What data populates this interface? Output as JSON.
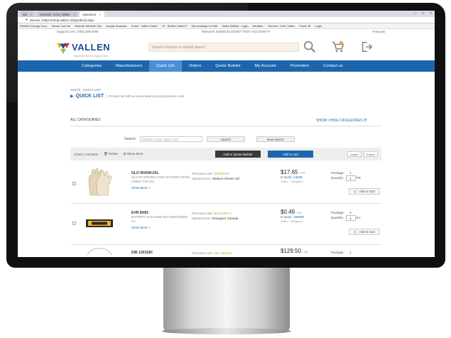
{
  "browser": {
    "tabs": [
      {
        "label": "ink",
        "close": "×"
      },
      {
        "label": "Yammer: CAN_Vallen",
        "close": "×"
      },
      {
        "label": "QuickList",
        "close": "×"
      }
    ],
    "window_controls": [
      "–",
      "□",
      "×"
    ],
    "address": "Secure | https://shop.vallen.ca/QuickList.aspx",
    "bookmarks": [
      "ENMAX Energy Corp.",
      "Bidnet user list",
      "Wheelin Website Sys",
      "Google Analytics",
      "Home · Vallen Home",
      "LP · BidNet Vallen P",
      "My meetings GoToM",
      "Vallen BidNet · Login",
      "Weather",
      "Yammer: CAN_Vallen",
      "Power BI",
      "Login"
    ]
  },
  "header": {
    "support": "Support Line: (780) 490-2695",
    "welcome": "Welcome 200000 ELEXNET TEST ACCOUNT ▾",
    "language": "Français",
    "logo_text": "VALLEN",
    "logo_tagline": "Workforce Driven Supply Chain",
    "search_placeholder": "Search Products in Global Search"
  },
  "nav": {
    "items": [
      "Categories",
      "Manufacturers",
      "Quick List",
      "Orders",
      "Quote Builder",
      "My Account",
      "Promotion",
      "Contact us"
    ]
  },
  "page": {
    "breadcrumb": "Search › QUICK LIST",
    "title": "QUICK LIST",
    "subtitle": "Product list with an associated personal product code",
    "all_categories": "ALL CATEGORIES",
    "show_hide": "SHOW / HIDE CATEGORIES",
    "search_label": "Search",
    "search_placeholder": "Search in your Quick List",
    "search_btn": "Search",
    "new_search_btn": "New search"
  },
  "toolbar": {
    "check_uncheck": "Check  |  Uncheck",
    "delete": "Delete",
    "show_more": "Show More",
    "add_quote": "Add to Quote Builder",
    "add_cart": "Add to cart",
    "import": "Import",
    "export": "Export"
  },
  "products": [
    {
      "code": "GLO 9542W-2XL",
      "desc": "GLOVE DRIVER COW OUTSIDE THINS LINED TAN 2XL",
      "show_more": "Show More +",
      "personal_code_label": "Personal code:",
      "personal_code": "9542W2XL",
      "manufacturer_label": "Manufacturer:",
      "manufacturer": "Watson Gloves Ltd",
      "price": "$17.65",
      "unit": "/ PR",
      "stock": "In stock: 14638",
      "location": "Vallen · Dartigues",
      "package_label": "Package:",
      "package": "1",
      "quantity_label": "Quantity:",
      "quantity": "1",
      "qty_unit": "PR",
      "add_btn": "Add to Cart"
    },
    {
      "code": "EVR EN91",
      "desc": "BATTERY ALKALINE IND ENERGIZER AA",
      "show_more": "Show More +",
      "personal_code_label": "Personal code:",
      "personal_code": "BUILDING 5",
      "manufacturer_label": "Manufacturer:",
      "manufacturer": "Energizer Canada",
      "price": "$0.49",
      "unit": "/ EA",
      "stock": "In stock: 165095",
      "location": "Vallen · Dartigues",
      "package_label": "Package:",
      "package": "4",
      "quantity_label": "Quantity:",
      "quantity": "1",
      "qty_unit": "EA",
      "add_btn": "Add to Cart"
    },
    {
      "code": "DIB 120318C",
      "desc": "",
      "show_more": "",
      "personal_code_label": "Personal code:",
      "personal_code": "DB 120318C",
      "manufacturer_label": "",
      "manufacturer": "",
      "price": "$129.50",
      "unit": "/ EA",
      "stock": "",
      "location": "",
      "package_label": "Package:",
      "package": "1",
      "quantity_label": "",
      "quantity": "",
      "qty_unit": "",
      "add_btn": ""
    }
  ],
  "colors": {
    "brand_blue": "#1d66ad",
    "nav_active": "#4a90d6",
    "code_green": "#8fbc2f",
    "bezel": "#101010"
  }
}
